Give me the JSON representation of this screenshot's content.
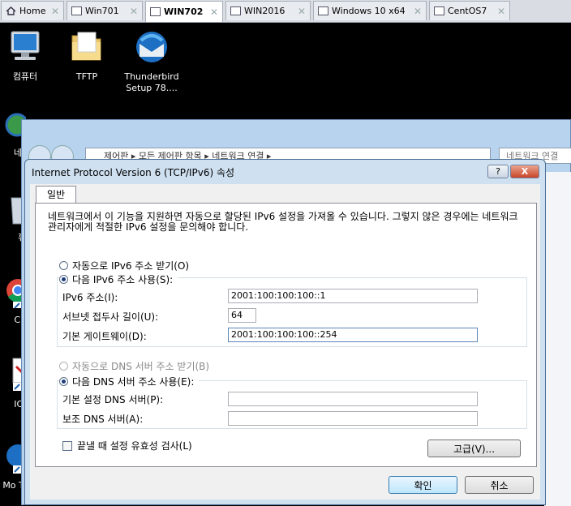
{
  "tabs": [
    {
      "label": "Home",
      "icon": "home-icon",
      "active": false
    },
    {
      "label": "Win701",
      "icon": "vm-icon",
      "active": false
    },
    {
      "label": "WIN702",
      "icon": "vm-icon",
      "active": true
    },
    {
      "label": "WIN2016",
      "icon": "vm-icon",
      "active": false
    },
    {
      "label": "Windows 10 x64",
      "icon": "vm-icon",
      "active": false
    },
    {
      "label": "CentOS7",
      "icon": "vm-icon",
      "active": false
    }
  ],
  "desktop": {
    "icons": [
      {
        "label": "컴퓨터",
        "icon": "computer-icon"
      },
      {
        "label": "TFTP",
        "icon": "folder-icon"
      },
      {
        "label": "Thunderbird Setup 78....",
        "icon": "thunderbird-icon"
      },
      {
        "label": "네트",
        "icon": "network-icon"
      },
      {
        "label": "휴",
        "icon": "recycle-bin-icon"
      },
      {
        "label": "Chr",
        "icon": "chrome-icon"
      },
      {
        "label": "ICO",
        "icon": "document-icon"
      },
      {
        "label": "Mo Thun",
        "icon": "thunderbird-icon"
      }
    ]
  },
  "explorer": {
    "address": "제어판 ▸ 모든 제어판 항목 ▸ 네트워크 연결 ▸",
    "search_placeholder": "네트워크 연결"
  },
  "dialog": {
    "title": "Internet Protocol Version 6 (TCP/IPv6) 속성",
    "help_label": "?",
    "close_label": "X",
    "tab_label": "일반",
    "description": "네트워크에서 이 기능을 지원하면 자동으로 할당된 IPv6 설정을 가져올 수 있습니다. 그렇지 않은 경우에는 네트워크 관리자에게 적절한 IPv6 설정을 문의해야 합니다.",
    "ip": {
      "auto_label": "자동으로 IPv6 주소 받기(O)",
      "manual_label": "다음 IPv6 주소 사용(S):",
      "address_label": "IPv6 주소(I):",
      "address_value": "2001:100:100:100::1",
      "prefix_label": "서브넷 접두사 길이(U):",
      "prefix_value": "64",
      "gateway_label": "기본 게이트웨이(D):",
      "gateway_value": "2001:100:100:100::254"
    },
    "dns": {
      "auto_label": "자동으로 DNS 서버 주소 받기(B)",
      "manual_label": "다음 DNS 서버 주소 사용(E):",
      "preferred_label": "기본 설정 DNS 서버(P):",
      "preferred_value": "",
      "alternate_label": "보조 DNS 서버(A):",
      "alternate_value": ""
    },
    "validate_label": "끝낼 때 설정 유효성 검사(L)",
    "advanced_label": "고급(V)...",
    "ok_label": "확인",
    "cancel_label": "취소"
  }
}
